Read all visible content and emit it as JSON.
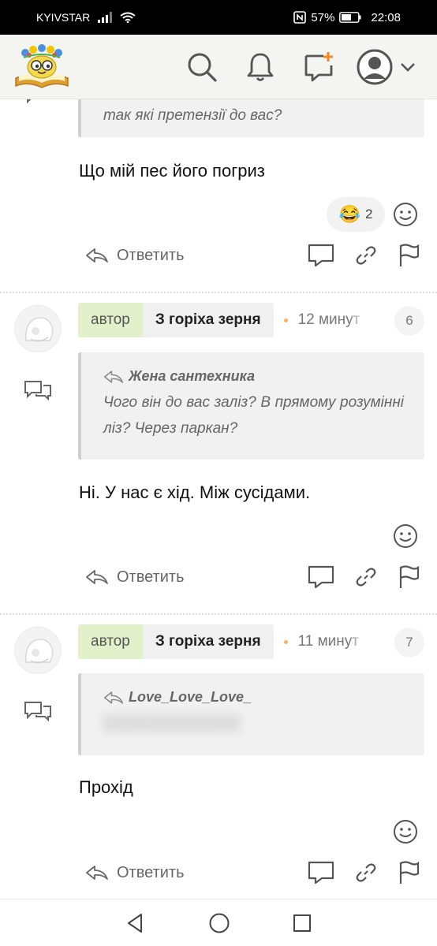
{
  "status_bar": {
    "carrier": "KYIVSTAR",
    "battery": "57%",
    "time": "22:08"
  },
  "header": {
    "icons": [
      "logo",
      "search-icon",
      "bell-icon",
      "new-post-icon",
      "avatar-icon",
      "chevron-down-icon"
    ]
  },
  "comments": [
    {
      "quote_text": "так які претензії до вас?",
      "text": "Що мій пес його погриз",
      "reaction_emoji": "😂",
      "reaction_count": "2",
      "reply_label": "Ответить"
    },
    {
      "author_tag": "автор",
      "nickname": "З горіха зерня",
      "time": "12 минут",
      "number": "6",
      "quote_author": "Жена сантехника",
      "quote_text": "Чого він до вас заліз? В прямому розумінні ліз? Через паркан?",
      "text": "Ні. У нас є хід. Між сусідами.",
      "reply_label": "Ответить"
    },
    {
      "author_tag": "автор",
      "nickname": "З горіха зерня",
      "time": "11 минут",
      "number": "7",
      "quote_author": "Love_Love_Love_",
      "quote_text": "▒▒▒▒▒▒▒▒▒▒▒▒",
      "text": "Прохід",
      "reply_label": "Ответить"
    }
  ],
  "colors": {
    "author_tag_bg": "#e3f1cb",
    "accent_orange": "#f08a24"
  }
}
